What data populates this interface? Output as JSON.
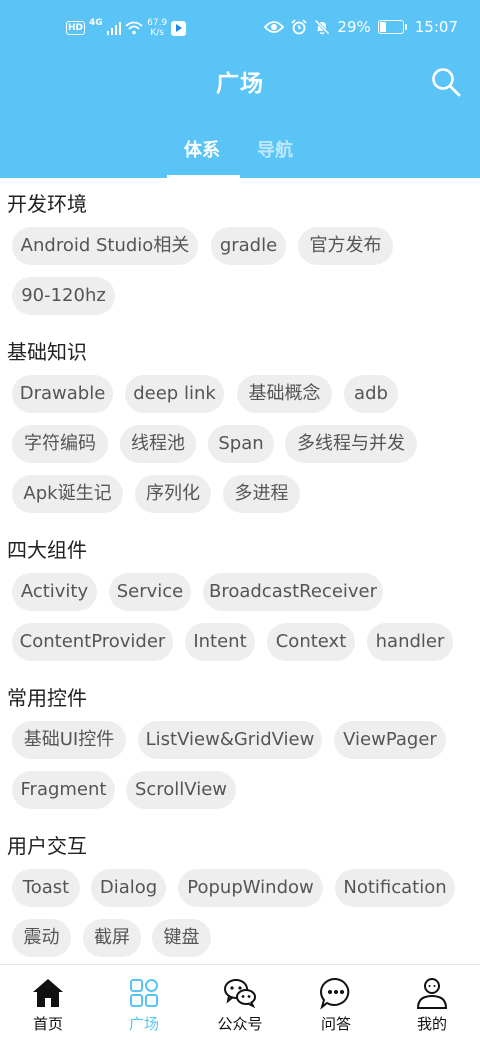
{
  "status_bar": {
    "network_type": "4G",
    "speed_value": "67.9",
    "speed_unit": "K/s",
    "battery": "29%",
    "time": "15:07"
  },
  "header": {
    "title": "广场",
    "tabs": [
      {
        "label": "体系",
        "active": true
      },
      {
        "label": "导航",
        "active": false
      }
    ]
  },
  "sections": [
    {
      "title": "开发环境",
      "chips": [
        "Android Studio相关",
        "gradle",
        "官方发布",
        "90-120hz"
      ]
    },
    {
      "title": "基础知识",
      "chips": [
        "Drawable",
        "deep link",
        "基础概念",
        "adb",
        "字符编码",
        "线程池",
        "Span",
        "多线程与并发",
        "Apk诞生记",
        "序列化",
        "多进程"
      ]
    },
    {
      "title": "四大组件",
      "chips": [
        "Activity",
        "Service",
        "BroadcastReceiver",
        "ContentProvider",
        "Intent",
        "Context",
        "handler"
      ]
    },
    {
      "title": "常用控件",
      "chips": [
        "基础UI控件",
        "ListView&GridView",
        "ViewPager",
        "Fragment",
        "ScrollView"
      ]
    },
    {
      "title": "用户交互",
      "chips": [
        "Toast",
        "Dialog",
        "PopupWindow",
        "Notification",
        "震动",
        "截屏",
        "键盘"
      ]
    }
  ],
  "bottom_nav": [
    {
      "label": "首页",
      "icon": "home-icon",
      "active": false
    },
    {
      "label": "广场",
      "icon": "grid-icon",
      "active": true
    },
    {
      "label": "公众号",
      "icon": "wechat-icon",
      "active": false
    },
    {
      "label": "问答",
      "icon": "chat-bubble-icon",
      "active": false
    },
    {
      "label": "我的",
      "icon": "user-icon",
      "active": false
    }
  ],
  "colors": {
    "accent": "#5bc4f7",
    "chip_bg": "#eeeeee",
    "chip_text": "#555555"
  }
}
